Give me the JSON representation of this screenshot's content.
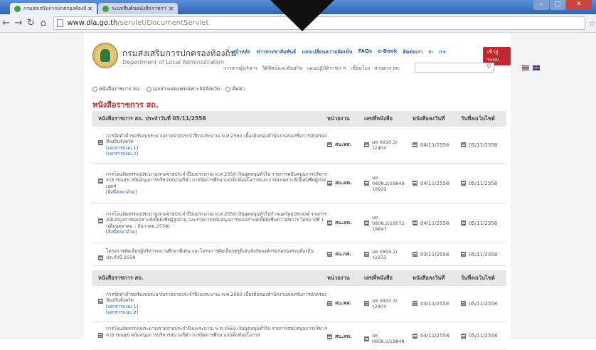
{
  "browser": {
    "tabs": [
      {
        "label": "กรมส่งเสริมการปกครองท้องถิ่น"
      },
      {
        "label": "ระบบสืบค้นหนังสือราชการ"
      }
    ],
    "url_host": "www.dla.go.th",
    "url_path": "/servlet/DocumentServlet"
  },
  "site": {
    "name_th": "กรมส่งเสริมการปกครองท้องถิ่น",
    "name_en": "Department of Local Administration",
    "nav": [
      "หน้าหลัก",
      "ข่าวประชาสัมพันธ์",
      "แลกเปลี่ยนความคิดเห็น",
      "FAQs",
      "e-Book",
      "ติดต่อเรา",
      "ก-",
      "ก+"
    ],
    "join_label": "เข้าสู่ระบบ",
    "subnav": [
      "วารสารผู้บริหาร",
      "วีดิทัศน์และพันธกิจ",
      "แผนปฏิบัติราชการ",
      "เชื่อมโยง",
      "สายตรง สถ."
    ]
  },
  "search_options": [
    "หนังสือราชการ สถ.",
    "เอกสารเผยแพร่เฉพาะกิจจังหวัด",
    "ค้นหา"
  ],
  "section_title": "หนังสือราชการ สถ.",
  "table1": {
    "headers": [
      "หนังสือราชการ สถ. ประจำวันที่ 05/11/2558",
      "หน่วยงาน",
      "เลขที่หนังสือ",
      "หนังสือลงวันที่",
      "วันที่ลงเว็บไซต์"
    ],
    "rows": [
      {
        "subject": "การจัดทำคำขอรับงบประมาณรายจ่ายประจำปีงบประมาณ พ.ศ.2560 เบื้องต้นของสำนักงานส่งเสริมการปกครองท้องถิ่นจังหวัด",
        "links": [
          "[เอกสารแนบ 1]",
          "[เอกสารแนบ 2]"
        ],
        "unit": "สน.พส.",
        "docno": "มท 0810.3/ ว2404",
        "doc_date": "04/11/2558",
        "post_date": "05/11/2558"
      },
      {
        "subject": "การโอนจัดสรรงบประมาณรายจ่ายประจำปีงบประมาณ พ.ศ.2559 เงินอุดหนุนทั่วไป รายการสนับสนุนการบริหารสาธารณสุข สนับสนุนการบริหารสนามกีฬา การจัดการศึกษาแก่เด็กด้อยโอกาสและการสงเคราะห์เบี้ยยังชีพผู้ป่วยเอดส์",
        "links": [
          "[สิ่งที่ส่งมาด้วย]"
        ],
        "unit": "สน.คท.",
        "docno": "มท 0808.2/18848-18923",
        "doc_date": "04/11/2558",
        "post_date": "05/11/2558"
      },
      {
        "subject": "การโอนจัดสรรงบประมาณรายจ่ายประจำปีงบประมาณ พ.ศ.2559 เงินอุดหนุนทั่วไปกำหนดวัตถุประสงค์ รายการสนับสนุนการสงเคราะห์เบี้ยยังชีพผู้สูงอายุ และรายการสนับสนุนการสงเคราะห์เบี้ยยังชีพความพิการ ไตรมาสที่ 1 (เดือนตุลาคม - ธันวาคม 2558)",
        "links": [
          "[สิ่งที่ส่งมาด้วย]"
        ],
        "unit": "สน.คท.",
        "docno": "มท 0808.2/18572-18647",
        "doc_date": "04/11/2558",
        "post_date": "05/11/2558"
      },
      {
        "subject": "โครงการคัดเลือกผู้บริหารสถานศึกษาดีเด่น และโครงการคัดเลือกครูดีเด่นสังกัดองค์กรปกครองส่วนท้องถิ่น ประจำปี 2558",
        "links": [],
        "unit": "สน.กศ.",
        "docno": "มท 0893.2/ ว2373",
        "doc_date": "03/11/2558",
        "post_date": "05/11/2558"
      }
    ]
  },
  "table2": {
    "headers": [
      "หนังสือราชการ สถ.",
      "หน่วยงาน",
      "เลขที่หนังสือ",
      "หนังสือลงวันที่",
      "วันที่ลงเว็บไซต์"
    ],
    "rows": [
      {
        "subject": "การจัดทำคำขอรับงบประมาณรายจ่ายประจำปีงบประมาณ พ.ศ.2560 เบื้องต้นของสำนักงานส่งเสริมการปกครองท้องถิ่นจังหวัด",
        "links": [
          "[เอกสารแนบ 1]",
          "[เอกสารแนบ 2]"
        ],
        "unit": "สน.พส.",
        "docno": "มท 0810.3/ ว2404",
        "doc_date": "04/11/2558",
        "post_date": "05/11/2558"
      },
      {
        "subject": "การโอนจัดสรรงบประมาณรายจ่ายประจำปีงบประมาณ พ.ศ.2559 เงินอุดหนุนทั่วไป รายการสนับสนุนการบริหารสาธารณสุข สนับสนุนการบริหารสนามกีฬา การจัดการศึกษาแก่เด็กด้อยโอกาส",
        "links": [],
        "unit": "สน.คท.",
        "docno": "มท 0808.2/18848-",
        "doc_date": "04/11/2558",
        "post_date": "05/11/2558"
      }
    ]
  }
}
